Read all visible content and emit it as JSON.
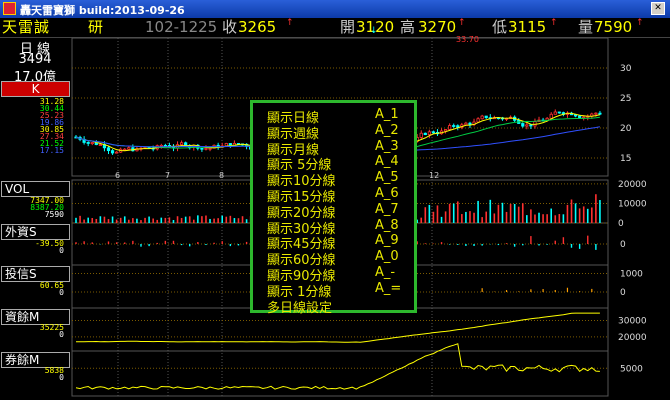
{
  "window": {
    "title": "轟天雷寶獅 build:2013-09-26"
  },
  "quote": {
    "name": "天雷誠",
    "tag": "研",
    "contract": "102-1225",
    "close_label": "收",
    "close": "3265",
    "open_label": "開",
    "open": "3120",
    "high_label": "高",
    "high": "3270",
    "low_label": "低",
    "low": "3115",
    "vol_label": "量",
    "vol": "7590"
  },
  "left": {
    "period": "日 線",
    "code": "3494",
    "amount": "17.0億",
    "k_button": "K",
    "k_vals": [
      {
        "t": "31.28",
        "c": "#ffff00"
      },
      {
        "t": "30.44",
        "c": "#00ff00"
      },
      {
        "t": "25.23",
        "c": "#ff4040"
      },
      {
        "t": "19.86",
        "c": "#4060ff"
      },
      {
        "t": "30.85",
        "c": "#ffff00"
      },
      {
        "t": "27.34",
        "c": "#ff4040"
      },
      {
        "t": "21.52",
        "c": "#00ff00"
      },
      {
        "t": "17.15",
        "c": "#4060ff"
      }
    ],
    "vol_button": "VOL",
    "vol_vals": [
      {
        "t": "7347.00",
        "c": "#ffff00"
      },
      {
        "t": "8387.20",
        "c": "#00ff00"
      },
      {
        "t": "7590",
        "c": "#ffffff"
      }
    ],
    "foreign_button": "外資S",
    "foreign_vals": [
      {
        "t": "-39.50",
        "c": "#ffff00"
      },
      {
        "t": "0",
        "c": "#ffffff"
      }
    ],
    "trust_button": "投信S",
    "trust_vals": [
      {
        "t": "60.65",
        "c": "#ffff00"
      },
      {
        "t": "0",
        "c": "#ffffff"
      }
    ],
    "margin_button": "資餘M",
    "margin_vals": [
      {
        "t": "35225",
        "c": "#ffff00"
      },
      {
        "t": "0",
        "c": "#ffffff"
      }
    ],
    "short_button": "券餘M",
    "short_vals": [
      {
        "t": "5838",
        "c": "#ffff00"
      },
      {
        "t": "0",
        "c": "#ffffff"
      }
    ]
  },
  "axes": {
    "price_ticks": [
      "30",
      "25",
      "20",
      "15"
    ],
    "vol_ticks": [
      "20000",
      "10000",
      "0"
    ],
    "foreign_ticks": [
      "0"
    ],
    "trust_ticks": [
      "1000",
      "0"
    ],
    "margin_ticks": [
      "30000",
      "20000"
    ],
    "short_ticks": [
      "5000"
    ],
    "months": [
      "6",
      "7",
      "8",
      "12"
    ],
    "hi_label": "33.70"
  },
  "menu": {
    "items": [
      {
        "label": "顯示日線",
        "key": "A_1"
      },
      {
        "label": "顯示週線",
        "key": "A_2"
      },
      {
        "label": "顯示月線",
        "key": "A_3"
      },
      {
        "label": "顯示 5分線",
        "key": "A_4"
      },
      {
        "label": "顯示10分線",
        "key": "A_5"
      },
      {
        "label": "顯示15分線",
        "key": "A_6"
      },
      {
        "label": "顯示20分線",
        "key": "A_7"
      },
      {
        "label": "顯示30分線",
        "key": "A_8"
      },
      {
        "label": "顯示45分線",
        "key": "A_9"
      },
      {
        "label": "顯示60分線",
        "key": "A_0"
      },
      {
        "label": "顯示90分線",
        "key": "A_-"
      },
      {
        "label": "顯示 1分線",
        "key": "A_="
      },
      {
        "label": "多日線設定",
        "key": ""
      }
    ]
  },
  "colors": {
    "up": "#ff3030",
    "down": "#00ffff",
    "ma1": "#ffff00",
    "ma2": "#00cc44",
    "ma3": "#3050ff",
    "menu_border": "#2db82d",
    "menu_text": "#e8e800"
  }
}
